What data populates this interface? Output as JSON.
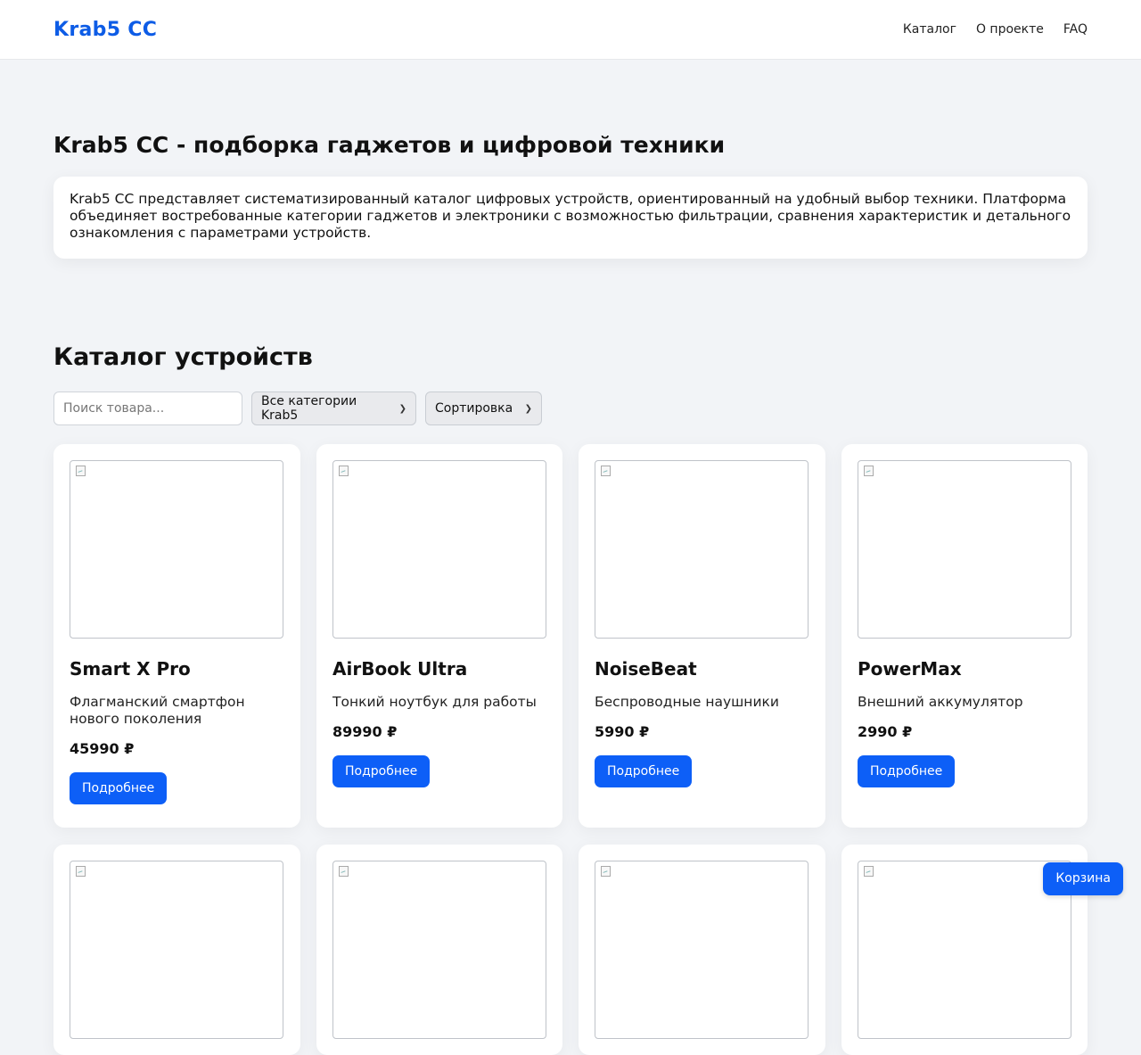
{
  "header": {
    "logo": "Krab5 CC",
    "nav": [
      "Каталог",
      "О проекте",
      "FAQ"
    ]
  },
  "about": {
    "title": "Krab5 CC - подборка гаджетов и цифровой техники",
    "text": "Krab5 CC представляет систематизированный каталог цифровых устройств, ориентированный на удобный выбор техники. Платформа объединяет востребованные категории гаджетов и электроники с возможностью фильтрации, сравнения характеристик и детального ознакомления с параметрами устройств."
  },
  "catalog": {
    "title": "Каталог устройств",
    "search_placeholder": "Поиск товара...",
    "category_select": "Все категории Krab5",
    "sort_select": "Сортировка",
    "products": [
      {
        "name": "Smart X Pro",
        "desc": "Флагманский смартфон нового поколения",
        "price": "45990 ₽",
        "button": "Подробнее"
      },
      {
        "name": "AirBook Ultra",
        "desc": "Тонкий ноутбук для работы",
        "price": "89990 ₽",
        "button": "Подробнее"
      },
      {
        "name": "NoiseBeat",
        "desc": "Беспроводные наушники",
        "price": "5990 ₽",
        "button": "Подробнее"
      },
      {
        "name": "PowerMax",
        "desc": "Внешний аккумулятор",
        "price": "2990 ₽",
        "button": "Подробнее"
      }
    ]
  },
  "cart_button": "Корзина",
  "icons": {
    "broken_image": "broken-image-icon",
    "chevron": "chevron-down-icon"
  },
  "colors": {
    "accent": "#0d5ff7",
    "logo": "#0d5ce6",
    "background": "#f2f4f7"
  }
}
